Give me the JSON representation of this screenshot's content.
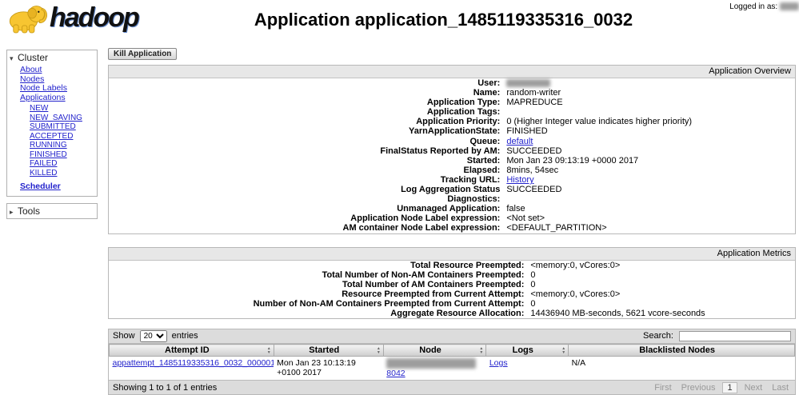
{
  "colors": {
    "link": "#2222cc",
    "brand_yellow": "#f7c531",
    "bar_gray": "#e7e7e7"
  },
  "icons": {
    "collapse_open": "▾",
    "collapse_closed": "▸",
    "sort_asc": "▲",
    "sort_desc": "▼"
  },
  "header": {
    "logo_text": "hadoop",
    "logged_in_label": "Logged in as:",
    "title": "Application application_1485119335316_0032"
  },
  "sidebar": {
    "cluster": {
      "label": "Cluster",
      "links": [
        "About",
        "Nodes",
        "Node Labels",
        "Applications"
      ],
      "app_states": [
        "NEW",
        "NEW_SAVING",
        "SUBMITTED",
        "ACCEPTED",
        "RUNNING",
        "FINISHED",
        "FAILED",
        "KILLED"
      ],
      "scheduler_label": "Scheduler"
    },
    "tools": {
      "label": "Tools"
    }
  },
  "main": {
    "kill_button_label": "Kill Application",
    "overview": {
      "title": "Application Overview",
      "rows": [
        {
          "label": "User:",
          "value": "",
          "redacted": true
        },
        {
          "label": "Name:",
          "value": "random-writer"
        },
        {
          "label": "Application Type:",
          "value": "MAPREDUCE"
        },
        {
          "label": "Application Tags:",
          "value": ""
        },
        {
          "label": "Application Priority:",
          "value": "0 (Higher Integer value indicates higher priority)"
        },
        {
          "label": "YarnApplicationState:",
          "value": "FINISHED"
        },
        {
          "label": "Queue:",
          "value": "default",
          "link": true
        },
        {
          "label": "FinalStatus Reported by AM:",
          "value": "SUCCEEDED"
        },
        {
          "label": "Started:",
          "value": "Mon Jan 23 09:13:19 +0000 2017"
        },
        {
          "label": "Elapsed:",
          "value": "8mins, 54sec"
        },
        {
          "label": "Tracking URL:",
          "value": "History",
          "link": true
        },
        {
          "label": "Log Aggregation Status",
          "value": "SUCCEEDED"
        },
        {
          "label": "Diagnostics:",
          "value": ""
        },
        {
          "label": "Unmanaged Application:",
          "value": "false"
        },
        {
          "label": "Application Node Label expression:",
          "value": "<Not set>"
        },
        {
          "label": "AM container Node Label expression:",
          "value": "<DEFAULT_PARTITION>"
        }
      ]
    },
    "metrics": {
      "title": "Application Metrics",
      "rows": [
        {
          "label": "Total Resource Preempted:",
          "value": "<memory:0, vCores:0>"
        },
        {
          "label": "Total Number of Non-AM Containers Preempted:",
          "value": "0"
        },
        {
          "label": "Total Number of AM Containers Preempted:",
          "value": "0"
        },
        {
          "label": "Resource Preempted from Current Attempt:",
          "value": "<memory:0, vCores:0>"
        },
        {
          "label": "Number of Non-AM Containers Preempted from Current Attempt:",
          "value": "0"
        },
        {
          "label": "Aggregate Resource Allocation:",
          "value": "14436940 MB-seconds, 5621 vcore-seconds"
        }
      ]
    },
    "attempts_table": {
      "show_label": "Show",
      "show_value": "20",
      "entries_label": "entries",
      "search_label": "Search:",
      "columns": [
        "Attempt ID",
        "Started",
        "Node",
        "Logs",
        "Blacklisted Nodes"
      ],
      "row": {
        "attempt_id": "appattempt_1485119335316_0032_000001",
        "started": "Mon Jan 23 10:13:19 +0100 2017",
        "node_port": "8042",
        "logs_label": "Logs",
        "blacklisted": "N/A"
      },
      "footer": {
        "showing": "Showing 1 to 1 of 1 entries",
        "pagination": [
          "First",
          "Previous",
          "1",
          "Next",
          "Last"
        ]
      }
    }
  }
}
